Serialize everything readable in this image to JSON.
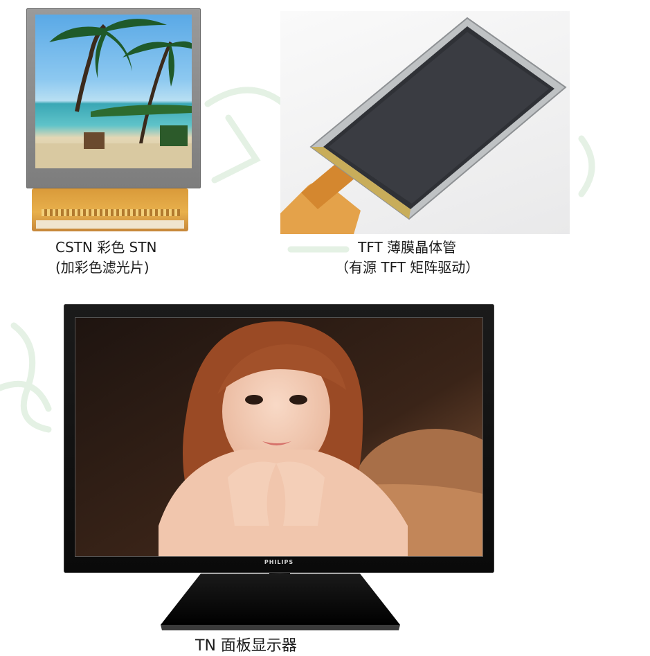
{
  "cstn": {
    "caption_line1": "CSTN 彩色 STN",
    "caption_line2": "(加彩色滤光片)"
  },
  "tft": {
    "caption_line1": "TFT 薄膜晶体管",
    "caption_line2": "（有源 TFT 矩阵驱动）"
  },
  "tn": {
    "brand": "PHILIPS",
    "caption": "TN 面板显示器"
  }
}
